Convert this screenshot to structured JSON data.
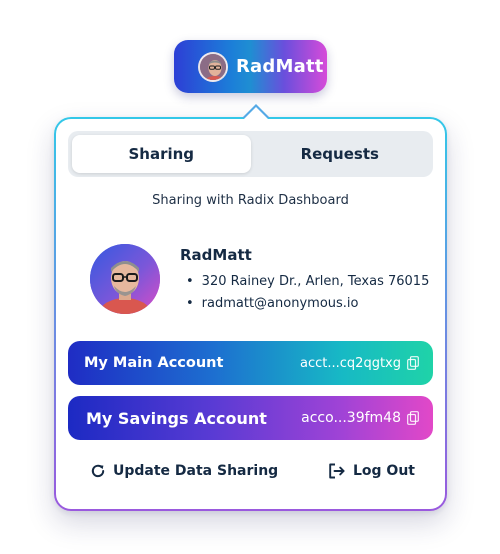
{
  "account_pill": {
    "name": "RadMatt"
  },
  "tabs": [
    {
      "label": "Sharing",
      "active": true
    },
    {
      "label": "Requests",
      "active": false
    }
  ],
  "sharing_with": "Sharing with Radix Dashboard",
  "persona": {
    "name": "RadMatt",
    "details": [
      "320 Rainey Dr., Arlen, Texas 76015",
      "radmatt@anonymous.io"
    ]
  },
  "accounts": [
    {
      "name": "My Main Account",
      "address": "acct...cq2qgtxg"
    },
    {
      "name": "My Savings Account",
      "address": "acco...39fm48"
    }
  ],
  "actions": {
    "update_label": "Update Data Sharing",
    "logout_label": "Log Out"
  },
  "colors": {
    "text_primary": "#152a43",
    "tab_track": "#e8ecf0",
    "card_border_top": "#33c8e8",
    "card_border_bottom": "#9a59de"
  },
  "icons": {
    "copy": "copy-icon",
    "refresh": "refresh-icon",
    "logout": "logout-icon"
  }
}
